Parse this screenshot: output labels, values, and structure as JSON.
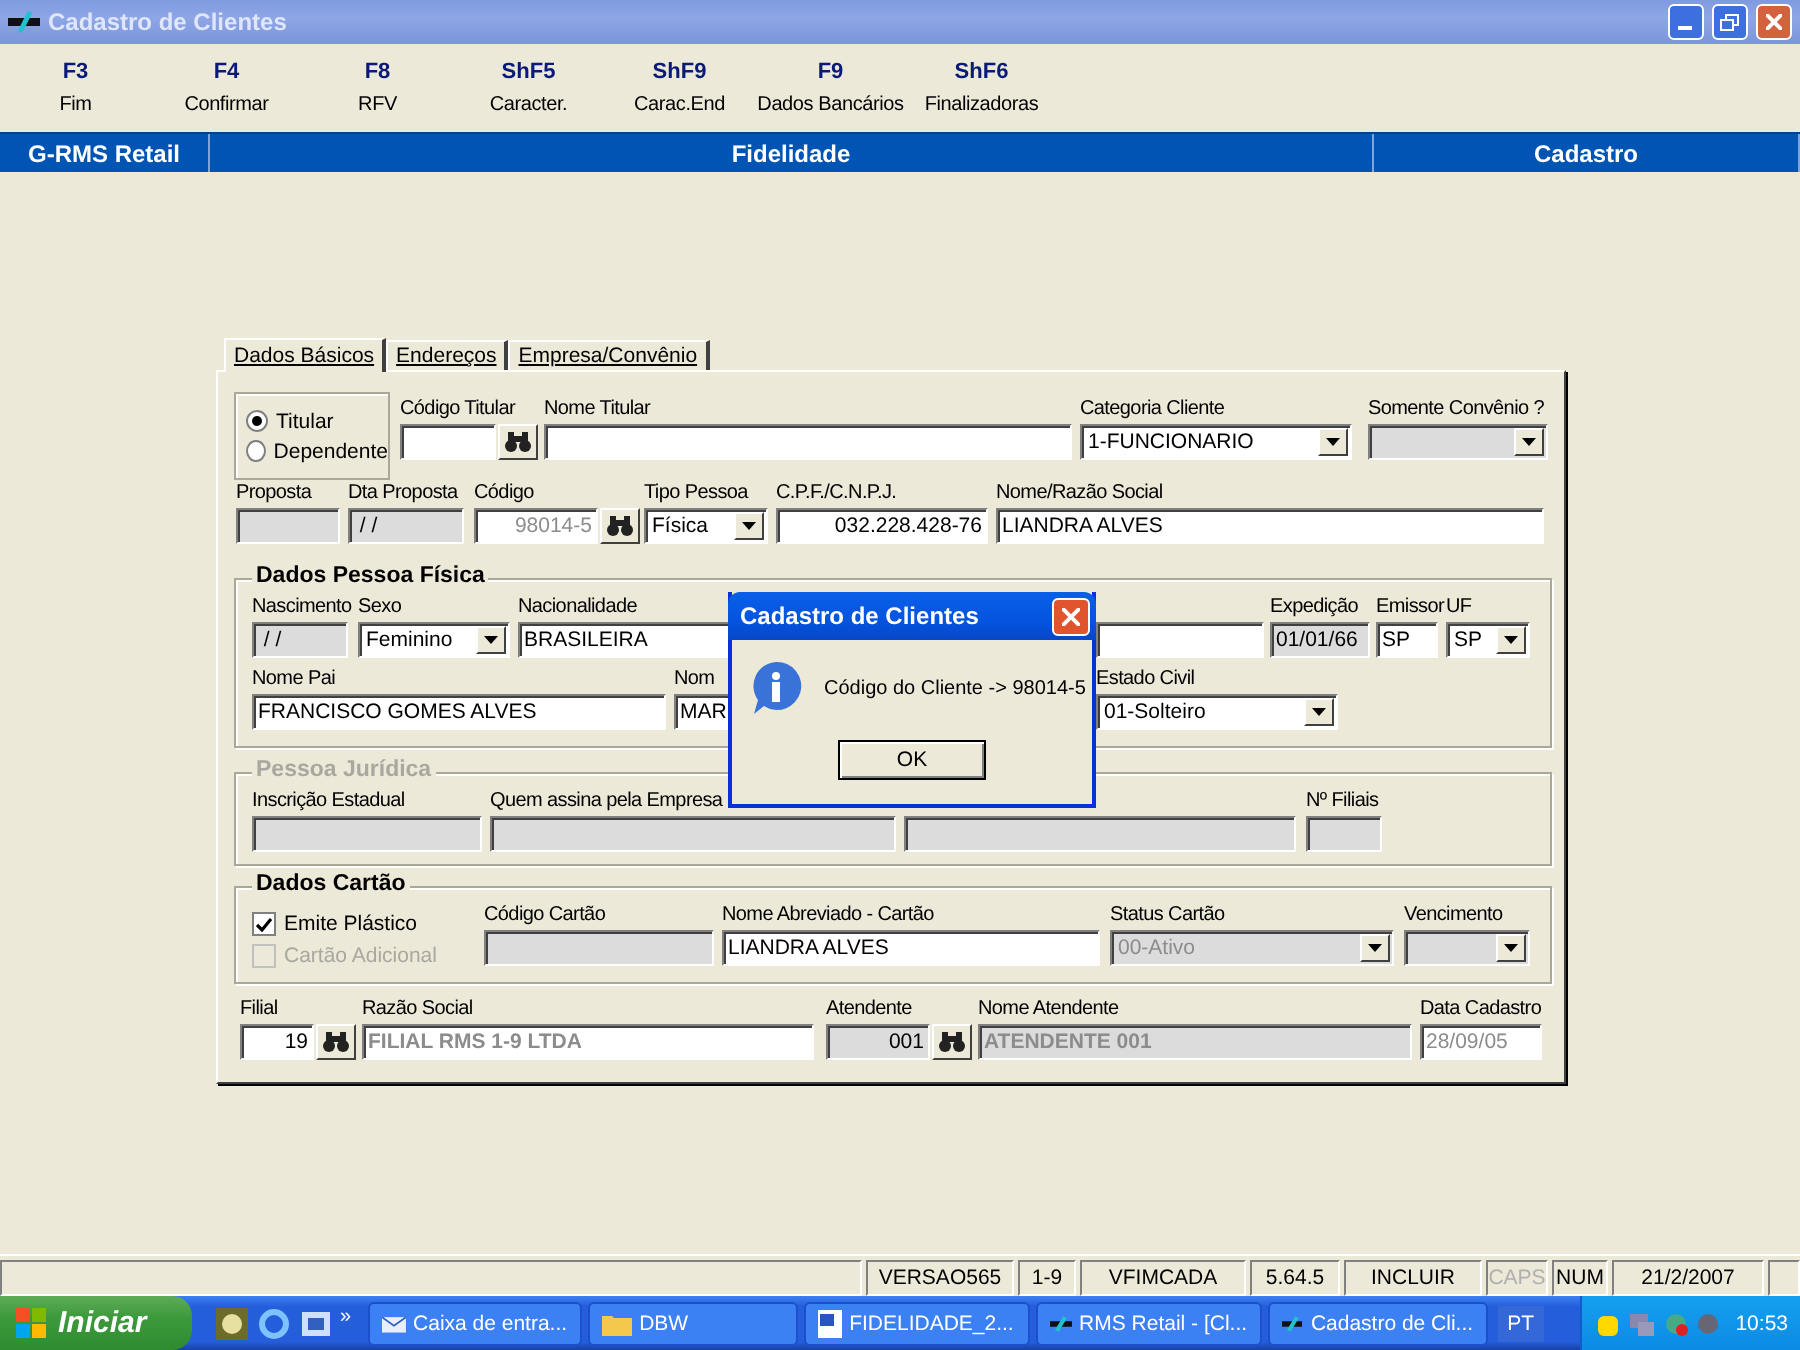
{
  "window": {
    "title": "Cadastro de Clientes"
  },
  "function_keys": [
    {
      "key": "F3",
      "label": "Fim"
    },
    {
      "key": "F4",
      "label": "Confirmar"
    },
    {
      "key": "F8",
      "label": "RFV"
    },
    {
      "key": "ShF5",
      "label": "Caracter."
    },
    {
      "key": "ShF9",
      "label": "Carac.End"
    },
    {
      "key": "F9",
      "label": "Dados Bancários"
    },
    {
      "key": "ShF6",
      "label": "Finalizadoras"
    }
  ],
  "header": {
    "left": "G-RMS Retail",
    "center": "Fidelidade",
    "right": "Cadastro"
  },
  "tabs": [
    {
      "label": "Dados Básicos",
      "selected": true
    },
    {
      "label": "Endereços",
      "selected": false
    },
    {
      "label": "Empresa/Convênio",
      "selected": false
    }
  ],
  "sections": [
    {
      "kind": "plain",
      "rows": [
        {
          "options": [
            {
              "label": "Titular",
              "selected": true
            },
            {
              "label": "Dependente",
              "selected": false
            }
          ],
          "fields": [
            {
              "label": "Código Titular",
              "kind": "lookup",
              "disabled": false
            },
            {
              "label": "Nome Titular",
              "kind": "text",
              "disabled": false
            },
            {
              "label": "Categoria Cliente",
              "kind": "select",
              "disabled": false,
              "value": "1-FUNCIONARIO"
            },
            {
              "label": "Somente Convênio ?",
              "kind": "select",
              "disabled": true
            }
          ]
        },
        {
          "fields": [
            {
              "label": "Proposta",
              "kind": "text",
              "disabled": true
            },
            {
              "label": "Dta Proposta",
              "kind": "text",
              "disabled": true,
              "readonly": false,
              "value": " / /"
            },
            {
              "label": "Código",
              "kind": "lookup",
              "disabled": false,
              "readonly": true,
              "value": "98014-5"
            },
            {
              "label": "Tipo Pessoa",
              "kind": "select",
              "disabled": false,
              "value": "Física"
            },
            {
              "label": "C.P.F./C.N.P.J.",
              "kind": "number",
              "disabled": false,
              "readonly": false,
              "value": "032.228.428-76"
            },
            {
              "label": "Nome/Razão Social",
              "kind": "text",
              "disabled": false,
              "readonly": false,
              "value": "LIANDRA ALVES"
            }
          ]
        }
      ]
    },
    {
      "kind": "group",
      "title": "Dados Pessoa Física",
      "disabled": false,
      "rows": [
        {
          "fields": [
            {
              "label": "Nascimento",
              "kind": "text",
              "disabled": true,
              "readonly": false,
              "value": " / /"
            },
            {
              "label": "Sexo",
              "kind": "select",
              "disabled": false,
              "value": "Feminino"
            },
            {
              "label": "Nacionalidade",
              "kind": "text",
              "disabled": false,
              "readonly": false,
              "value": "BRASILEIRA"
            },
            {
              "kind": "text",
              "disabled": false
            },
            {
              "label": "Expedição",
              "kind": "text",
              "disabled": true,
              "readonly": false,
              "value": "01/01/66"
            },
            {
              "label": "Emissor",
              "kind": "text",
              "disabled": false,
              "readonly": false,
              "value": "SP"
            },
            {
              "label": "UF",
              "kind": "select",
              "disabled": false,
              "value": "SP"
            }
          ]
        },
        {
          "fields": [
            {
              "label": "Nome Pai",
              "kind": "text",
              "disabled": false,
              "readonly": false,
              "value": "FRANCISCO GOMES ALVES"
            },
            {
              "label": "Nom",
              "kind": "text",
              "disabled": false,
              "readonly": false,
              "value": "MAR"
            },
            {
              "label": "Estado Civil",
              "kind": "select",
              "disabled": false,
              "value": "01-Solteiro"
            }
          ]
        }
      ]
    },
    {
      "kind": "group",
      "title": "Pessoa Jurídica",
      "disabled": true,
      "rows": [
        {
          "fields": [
            {
              "label": "Inscrição Estadual",
              "kind": "text",
              "disabled": true
            },
            {
              "label": "Quem assina pela Empresa",
              "kind": "text",
              "disabled": true
            },
            {
              "kind": "text",
              "disabled": true
            },
            {
              "label": "Nº Filiais",
              "kind": "text",
              "disabled": true
            }
          ]
        }
      ]
    },
    {
      "kind": "group",
      "title": "Dados Cartão",
      "disabled": false,
      "rows": [
        {
          "checkboxes": [
            {
              "label": "Emite Plástico",
              "checked": true,
              "disabled": false
            },
            {
              "label": "Cartão Adicional",
              "checked": false,
              "disabled": true
            }
          ],
          "fields": [
            {
              "label": "Código Cartão",
              "kind": "text",
              "disabled": true
            },
            {
              "label": "Nome Abreviado - Cartão",
              "kind": "text",
              "disabled": false,
              "readonly": false,
              "value": "LIANDRA ALVES"
            },
            {
              "label": "Status Cartão",
              "kind": "select",
              "disabled": true,
              "value": "00-Ativo"
            },
            {
              "label": "Vencimento",
              "kind": "select",
              "disabled": true
            }
          ]
        }
      ]
    },
    {
      "kind": "plain",
      "rows": [
        {
          "fields": [
            {
              "label": "Filial",
              "kind": "lookup",
              "disabled": false,
              "readonly": false,
              "value": "19"
            },
            {
              "label": "Razão Social",
              "kind": "text",
              "disabled": false,
              "readonly": true,
              "bold": true,
              "value": "FILIAL RMS 1-9 LTDA"
            },
            {
              "label": "Atendente",
              "kind": "lookup",
              "disabled": true,
              "readonly": false,
              "value": "001"
            },
            {
              "label": "Nome Atendente",
              "kind": "text",
              "disabled": true,
              "readonly": true,
              "bold": true,
              "value": "ATENDENTE 001"
            },
            {
              "label": "Data Cadastro",
              "kind": "text",
              "disabled": false,
              "readonly": true,
              "value": "28/09/05"
            }
          ]
        }
      ]
    }
  ],
  "dialog": {
    "title": "Cadastro de Clientes",
    "message": "Código do Cliente -> 98014-5",
    "button": "OK"
  },
  "status_bar": [
    {
      "text": "VERSAO565",
      "disabled": false
    },
    {
      "text": "1-9",
      "disabled": false
    },
    {
      "text": "VFIMCADA",
      "disabled": false
    },
    {
      "text": "5.64.5",
      "disabled": false
    },
    {
      "text": "INCLUIR",
      "disabled": false
    },
    {
      "text": "CAPS",
      "disabled": true
    },
    {
      "text": "NUM",
      "disabled": false
    },
    {
      "text": "21/2/2007",
      "disabled": false
    }
  ],
  "taskbar": {
    "start": "Iniciar",
    "more": "»",
    "buttons": [
      {
        "label": "Caixa de entra...",
        "kind": "mail"
      },
      {
        "label": "DBW",
        "kind": "folder"
      },
      {
        "label": "FIDELIDADE_2...",
        "kind": "document"
      },
      {
        "label": "RMS Retail - [Cl...",
        "kind": "app"
      },
      {
        "label": "Cadastro de Cli...",
        "kind": "app"
      }
    ],
    "language": "PT",
    "clock": "10:53"
  }
}
